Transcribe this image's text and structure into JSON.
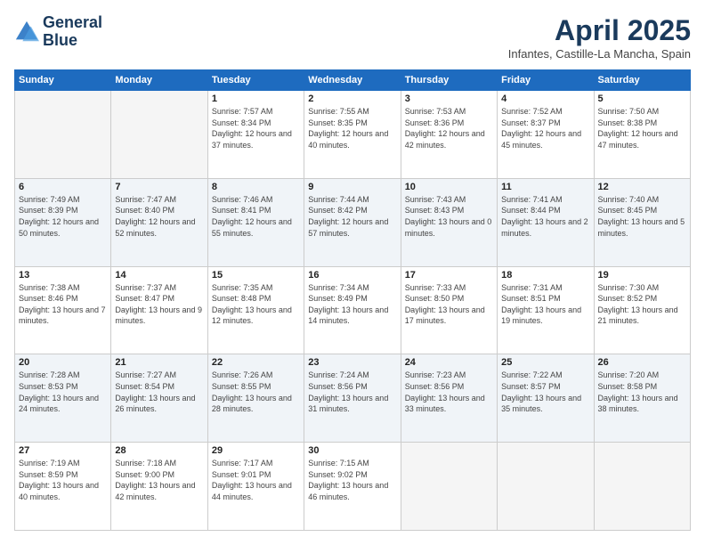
{
  "header": {
    "logo_line1": "General",
    "logo_line2": "Blue",
    "month": "April 2025",
    "location": "Infantes, Castille-La Mancha, Spain"
  },
  "days_of_week": [
    "Sunday",
    "Monday",
    "Tuesday",
    "Wednesday",
    "Thursday",
    "Friday",
    "Saturday"
  ],
  "weeks": [
    [
      {
        "day": "",
        "info": ""
      },
      {
        "day": "",
        "info": ""
      },
      {
        "day": "1",
        "info": "Sunrise: 7:57 AM\nSunset: 8:34 PM\nDaylight: 12 hours and 37 minutes."
      },
      {
        "day": "2",
        "info": "Sunrise: 7:55 AM\nSunset: 8:35 PM\nDaylight: 12 hours and 40 minutes."
      },
      {
        "day": "3",
        "info": "Sunrise: 7:53 AM\nSunset: 8:36 PM\nDaylight: 12 hours and 42 minutes."
      },
      {
        "day": "4",
        "info": "Sunrise: 7:52 AM\nSunset: 8:37 PM\nDaylight: 12 hours and 45 minutes."
      },
      {
        "day": "5",
        "info": "Sunrise: 7:50 AM\nSunset: 8:38 PM\nDaylight: 12 hours and 47 minutes."
      }
    ],
    [
      {
        "day": "6",
        "info": "Sunrise: 7:49 AM\nSunset: 8:39 PM\nDaylight: 12 hours and 50 minutes."
      },
      {
        "day": "7",
        "info": "Sunrise: 7:47 AM\nSunset: 8:40 PM\nDaylight: 12 hours and 52 minutes."
      },
      {
        "day": "8",
        "info": "Sunrise: 7:46 AM\nSunset: 8:41 PM\nDaylight: 12 hours and 55 minutes."
      },
      {
        "day": "9",
        "info": "Sunrise: 7:44 AM\nSunset: 8:42 PM\nDaylight: 12 hours and 57 minutes."
      },
      {
        "day": "10",
        "info": "Sunrise: 7:43 AM\nSunset: 8:43 PM\nDaylight: 13 hours and 0 minutes."
      },
      {
        "day": "11",
        "info": "Sunrise: 7:41 AM\nSunset: 8:44 PM\nDaylight: 13 hours and 2 minutes."
      },
      {
        "day": "12",
        "info": "Sunrise: 7:40 AM\nSunset: 8:45 PM\nDaylight: 13 hours and 5 minutes."
      }
    ],
    [
      {
        "day": "13",
        "info": "Sunrise: 7:38 AM\nSunset: 8:46 PM\nDaylight: 13 hours and 7 minutes."
      },
      {
        "day": "14",
        "info": "Sunrise: 7:37 AM\nSunset: 8:47 PM\nDaylight: 13 hours and 9 minutes."
      },
      {
        "day": "15",
        "info": "Sunrise: 7:35 AM\nSunset: 8:48 PM\nDaylight: 13 hours and 12 minutes."
      },
      {
        "day": "16",
        "info": "Sunrise: 7:34 AM\nSunset: 8:49 PM\nDaylight: 13 hours and 14 minutes."
      },
      {
        "day": "17",
        "info": "Sunrise: 7:33 AM\nSunset: 8:50 PM\nDaylight: 13 hours and 17 minutes."
      },
      {
        "day": "18",
        "info": "Sunrise: 7:31 AM\nSunset: 8:51 PM\nDaylight: 13 hours and 19 minutes."
      },
      {
        "day": "19",
        "info": "Sunrise: 7:30 AM\nSunset: 8:52 PM\nDaylight: 13 hours and 21 minutes."
      }
    ],
    [
      {
        "day": "20",
        "info": "Sunrise: 7:28 AM\nSunset: 8:53 PM\nDaylight: 13 hours and 24 minutes."
      },
      {
        "day": "21",
        "info": "Sunrise: 7:27 AM\nSunset: 8:54 PM\nDaylight: 13 hours and 26 minutes."
      },
      {
        "day": "22",
        "info": "Sunrise: 7:26 AM\nSunset: 8:55 PM\nDaylight: 13 hours and 28 minutes."
      },
      {
        "day": "23",
        "info": "Sunrise: 7:24 AM\nSunset: 8:56 PM\nDaylight: 13 hours and 31 minutes."
      },
      {
        "day": "24",
        "info": "Sunrise: 7:23 AM\nSunset: 8:56 PM\nDaylight: 13 hours and 33 minutes."
      },
      {
        "day": "25",
        "info": "Sunrise: 7:22 AM\nSunset: 8:57 PM\nDaylight: 13 hours and 35 minutes."
      },
      {
        "day": "26",
        "info": "Sunrise: 7:20 AM\nSunset: 8:58 PM\nDaylight: 13 hours and 38 minutes."
      }
    ],
    [
      {
        "day": "27",
        "info": "Sunrise: 7:19 AM\nSunset: 8:59 PM\nDaylight: 13 hours and 40 minutes."
      },
      {
        "day": "28",
        "info": "Sunrise: 7:18 AM\nSunset: 9:00 PM\nDaylight: 13 hours and 42 minutes."
      },
      {
        "day": "29",
        "info": "Sunrise: 7:17 AM\nSunset: 9:01 PM\nDaylight: 13 hours and 44 minutes."
      },
      {
        "day": "30",
        "info": "Sunrise: 7:15 AM\nSunset: 9:02 PM\nDaylight: 13 hours and 46 minutes."
      },
      {
        "day": "",
        "info": ""
      },
      {
        "day": "",
        "info": ""
      },
      {
        "day": "",
        "info": ""
      }
    ]
  ]
}
